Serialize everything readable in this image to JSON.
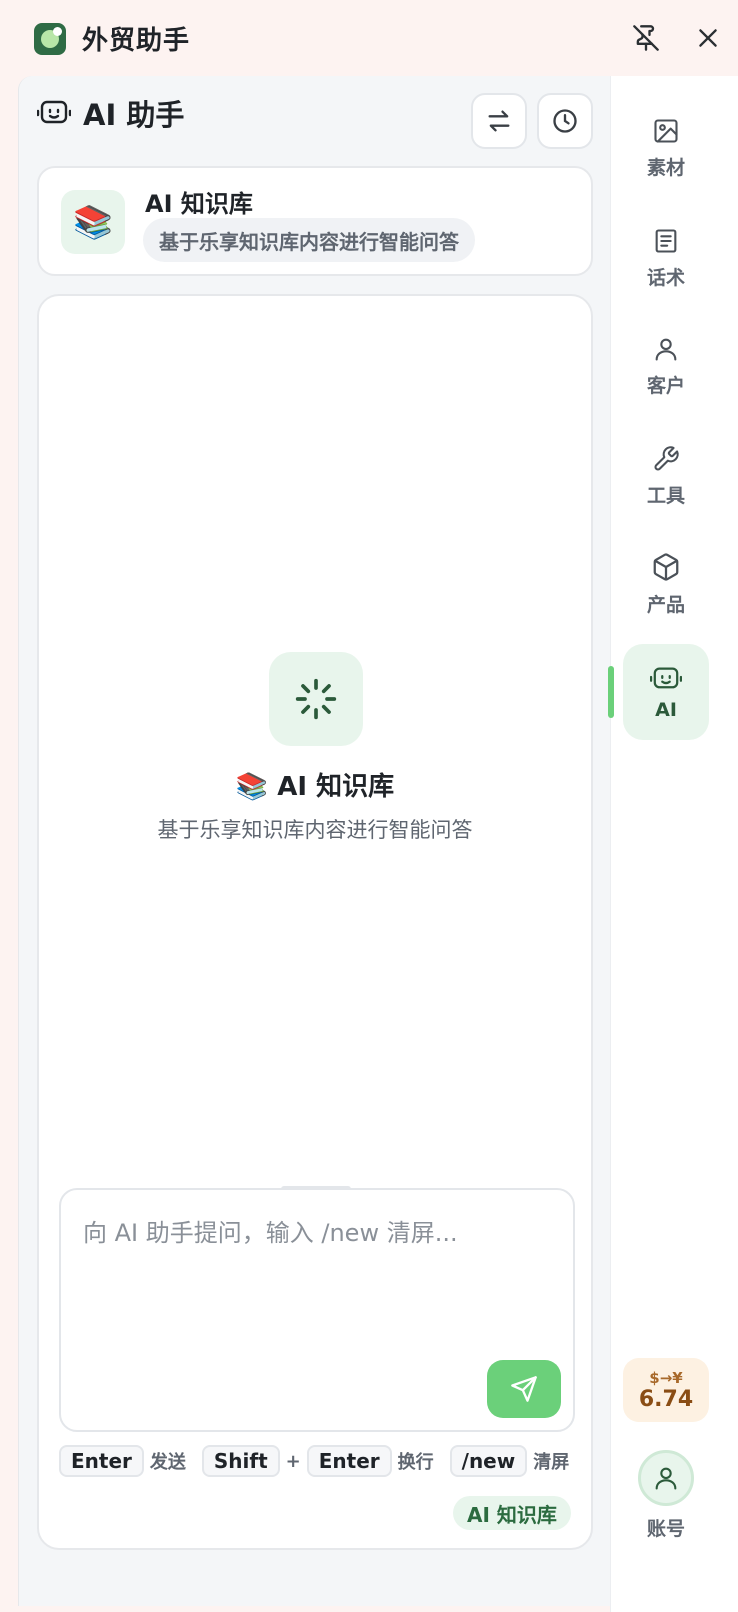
{
  "app": {
    "title": "外贸助手",
    "logo_icon": "app-logo-icon"
  },
  "titlebar": {
    "pin_icon": "pin-off-icon",
    "close_icon": "close-icon"
  },
  "header": {
    "title": "AI 助手",
    "icon": "robot-icon",
    "switch_icon": "swap-arrows-icon",
    "history_icon": "clock-icon"
  },
  "knowledge_card": {
    "emoji": "📚",
    "title": "AI 知识库",
    "description": "基于乐享知识库内容进行智能问答"
  },
  "empty_state": {
    "icon": "loading-spinner-icon",
    "title": "📚 AI 知识库",
    "description": "基于乐享知识库内容进行智能问答"
  },
  "input": {
    "value": "",
    "placeholder": "向 AI 助手提问，输入 /new 清屏..."
  },
  "shortcuts": [
    {
      "keys": [
        "Enter"
      ],
      "label": "发送"
    },
    {
      "keys": [
        "Shift",
        "Enter"
      ],
      "label": "换行"
    },
    {
      "keys": [
        "/new"
      ],
      "label": "清屏"
    }
  ],
  "shortcut_plus": "+",
  "mode_tag": "AI 知识库",
  "nav": {
    "items": [
      {
        "label": "素材",
        "icon": "image-icon",
        "active": false
      },
      {
        "label": "话术",
        "icon": "document-icon",
        "active": false
      },
      {
        "label": "客户",
        "icon": "user-icon",
        "active": false
      },
      {
        "label": "工具",
        "icon": "wrench-icon",
        "active": false
      },
      {
        "label": "产品",
        "icon": "box-icon",
        "active": false
      },
      {
        "label": "AI",
        "icon": "robot-icon",
        "active": true
      }
    ],
    "rate": {
      "pair": "$→¥",
      "value": "6.74"
    },
    "account": {
      "label": "账号",
      "icon": "user-icon"
    }
  },
  "colors": {
    "accent": "#6bd07a",
    "accent_soft": "#e8f5ec",
    "titlebar_bg": "#fdf3f1"
  }
}
